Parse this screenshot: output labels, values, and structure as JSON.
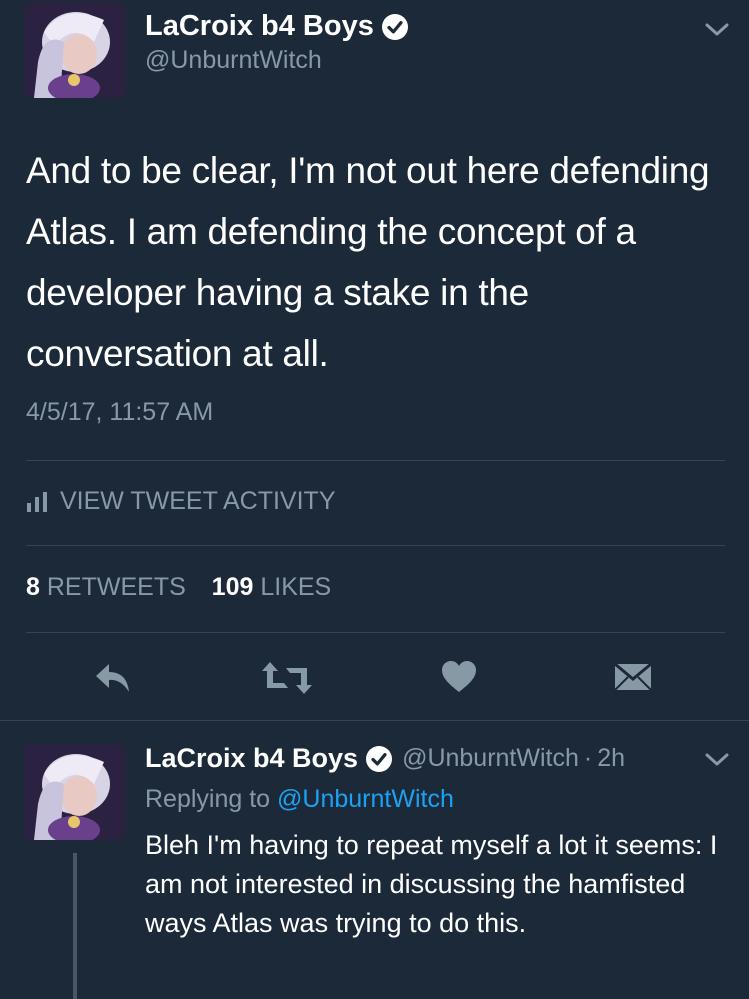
{
  "main_tweet": {
    "author_name": "LaCroix b4 Boys",
    "author_handle": "@UnburntWitch",
    "text": "And to be clear, I'm not out here defending Atlas. I am defending the concept of a developer having a stake in the conversation at all.",
    "timestamp": "4/5/17, 11:57 AM",
    "activity_label": "VIEW TWEET ACTIVITY",
    "retweets_count": "8",
    "retweets_label": "RETWEETS",
    "likes_count": "109",
    "likes_label": "LIKES"
  },
  "reply_tweet": {
    "author_name": "LaCroix b4 Boys",
    "author_handle": "@UnburntWitch",
    "time_ago": "2h",
    "replying_prefix": "Replying to",
    "replying_to": "@UnburntWitch",
    "text": "Bleh I'm having to repeat myself a lot it seems: I am not interested in discussing the hamfisted ways Atlas was trying to do this."
  },
  "colors": {
    "background": "#1c2938",
    "secondary_text": "#8899a6",
    "link": "#1da1f2",
    "divider": "#38444d"
  },
  "icons": [
    "verified-badge-icon",
    "chevron-down-icon",
    "bar-chart-icon",
    "reply-icon",
    "retweet-icon",
    "heart-icon",
    "envelope-icon"
  ]
}
